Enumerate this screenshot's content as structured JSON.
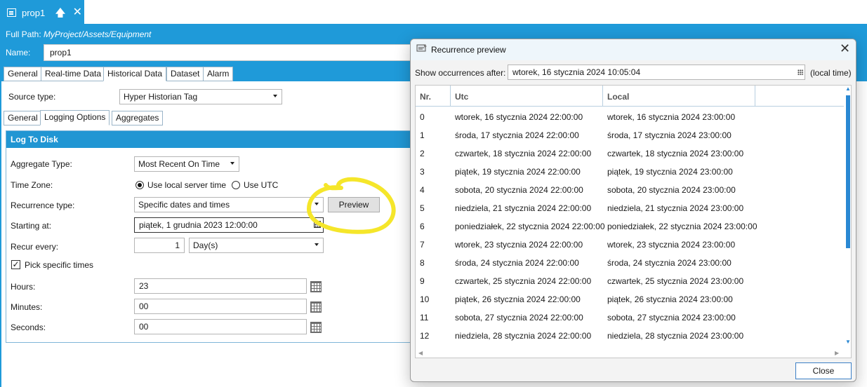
{
  "doc_tab": {
    "title": "prop1",
    "pin": "🡅",
    "close": "✕"
  },
  "header": {
    "full_path_label": "Full Path:",
    "full_path_value": "MyProject/Assets/Equipment",
    "name_label": "Name:",
    "name_value": "prop1"
  },
  "main_tabs": [
    "General",
    "Real-time Data",
    "Historical Data",
    "Dataset",
    "Alarm"
  ],
  "source": {
    "label": "Source type:",
    "value": "Hyper Historian Tag"
  },
  "sub_tabs": [
    "General",
    "Logging Options",
    "Aggregates"
  ],
  "log_to_disk": {
    "title": "Log To Disk",
    "aggregate_type_label": "Aggregate Type:",
    "aggregate_type_value": "Most Recent On Time",
    "time_zone_label": "Time Zone:",
    "tz_local": "Use local server time",
    "tz_utc": "Use UTC",
    "recurrence_type_label": "Recurrence type:",
    "recurrence_type_value": "Specific dates and times",
    "preview_button": "Preview",
    "starting_at_label": "Starting at:",
    "starting_at_value": "piątek, 1 grudnia 2023 12:00:00",
    "recur_every_label": "Recur every:",
    "recur_every_value": "1",
    "recur_unit": "Day(s)",
    "pick_times_label": "Pick specific times",
    "hours_label": "Hours:",
    "hours_value": "23",
    "minutes_label": "Minutes:",
    "minutes_value": "00",
    "seconds_label": "Seconds:",
    "seconds_value": "00"
  },
  "dialog": {
    "title": "Recurrence preview",
    "close_glyph": "✕",
    "show_after_label": "Show occurrences after:",
    "show_after_value": "wtorek, 16 stycznia 2024 10:05:04",
    "local_time": "(local time)",
    "columns": [
      "Nr.",
      "Utc",
      "Local"
    ],
    "rows": [
      [
        "0",
        "wtorek, 16 stycznia 2024 22:00:00",
        "wtorek, 16 stycznia 2024 23:00:00"
      ],
      [
        "1",
        "środa, 17 stycznia 2024 22:00:00",
        "środa, 17 stycznia 2024 23:00:00"
      ],
      [
        "2",
        "czwartek, 18 stycznia 2024 22:00:00",
        "czwartek, 18 stycznia 2024 23:00:00"
      ],
      [
        "3",
        "piątek, 19 stycznia 2024 22:00:00",
        "piątek, 19 stycznia 2024 23:00:00"
      ],
      [
        "4",
        "sobota, 20 stycznia 2024 22:00:00",
        "sobota, 20 stycznia 2024 23:00:00"
      ],
      [
        "5",
        "niedziela, 21 stycznia 2024 22:00:00",
        "niedziela, 21 stycznia 2024 23:00:00"
      ],
      [
        "6",
        "poniedziałek, 22 stycznia 2024 22:00:00",
        "poniedziałek, 22 stycznia 2024 23:00:00"
      ],
      [
        "7",
        "wtorek, 23 stycznia 2024 22:00:00",
        "wtorek, 23 stycznia 2024 23:00:00"
      ],
      [
        "8",
        "środa, 24 stycznia 2024 22:00:00",
        "środa, 24 stycznia 2024 23:00:00"
      ],
      [
        "9",
        "czwartek, 25 stycznia 2024 22:00:00",
        "czwartek, 25 stycznia 2024 23:00:00"
      ],
      [
        "10",
        "piątek, 26 stycznia 2024 22:00:00",
        "piątek, 26 stycznia 2024 23:00:00"
      ],
      [
        "11",
        "sobota, 27 stycznia 2024 22:00:00",
        "sobota, 27 stycznia 2024 23:00:00"
      ],
      [
        "12",
        "niedziela, 28 stycznia 2024 22:00:00",
        "niedziela, 28 stycznia 2024 23:00:00"
      ]
    ],
    "close_button": "Close"
  },
  "colors": {
    "accent": "#1f9ad9",
    "highlight": "#f5e62a"
  }
}
